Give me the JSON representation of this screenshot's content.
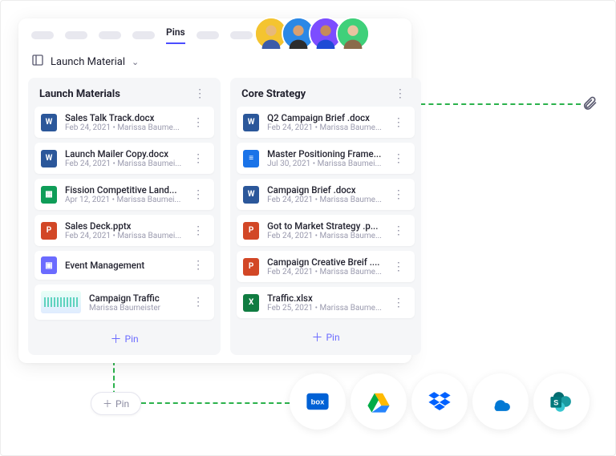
{
  "tabs": {
    "active": "Pins"
  },
  "breadcrumb": {
    "label": "Launch Material"
  },
  "avatars": [
    {
      "bg": "#f4c430"
    },
    {
      "bg": "#2b88e6"
    },
    {
      "bg": "#7c4dff"
    },
    {
      "bg": "#3fd07a"
    }
  ],
  "columns": [
    {
      "title": "Launch Materials",
      "items": [
        {
          "icon": "word",
          "name": "Sales Talk Track.docx",
          "meta": "Feb 24, 2021 • Marissa Baume..."
        },
        {
          "icon": "word",
          "name": "Launch Mailer Copy.docx",
          "meta": "Feb 24, 2021 • Marissa Baumei..."
        },
        {
          "icon": "sheets",
          "name": "Fission Competitive Land...",
          "meta": "Apr 12, 2021 • Marissa Baumei..."
        },
        {
          "icon": "ppt",
          "name": "Sales Deck.pptx",
          "meta": "Feb 24, 2021 • Marissa Baumei..."
        },
        {
          "icon": "folder",
          "name": "Event Management",
          "meta": ""
        },
        {
          "icon": "chart",
          "name": "Campaign Traffic",
          "meta": "Marissa Baumeister"
        }
      ],
      "pinLabel": "Pin"
    },
    {
      "title": "Core Strategy",
      "items": [
        {
          "icon": "word",
          "name": "Q2 Campaign Brief .docx",
          "meta": "Feb 24, 2021 • Marissa Baume..."
        },
        {
          "icon": "gdoc",
          "name": "Master Positioning Frame...",
          "meta": "Jul 30, 2021 • Marissa Baumei..."
        },
        {
          "icon": "word",
          "name": "Campaign Brief .docx",
          "meta": "Feb 24, 2021 • Marissa Baume..."
        },
        {
          "icon": "ppt",
          "name": "Got to Market Strategy .p...",
          "meta": "Feb 24, 2021 • Marissa Baume..."
        },
        {
          "icon": "ppt",
          "name": "Campaign Creative Breif ....",
          "meta": "Feb 24, 2021 • Marissa Baume..."
        },
        {
          "icon": "excel",
          "name": "Traffic.xlsx",
          "meta": "Feb 25, 2021 • Marissa Baume..."
        }
      ],
      "pinLabel": "Pin"
    }
  ],
  "floatingPin": "Pin",
  "integrations": [
    "box",
    "gdrive",
    "dropbox",
    "onedrive",
    "sharepoint"
  ]
}
